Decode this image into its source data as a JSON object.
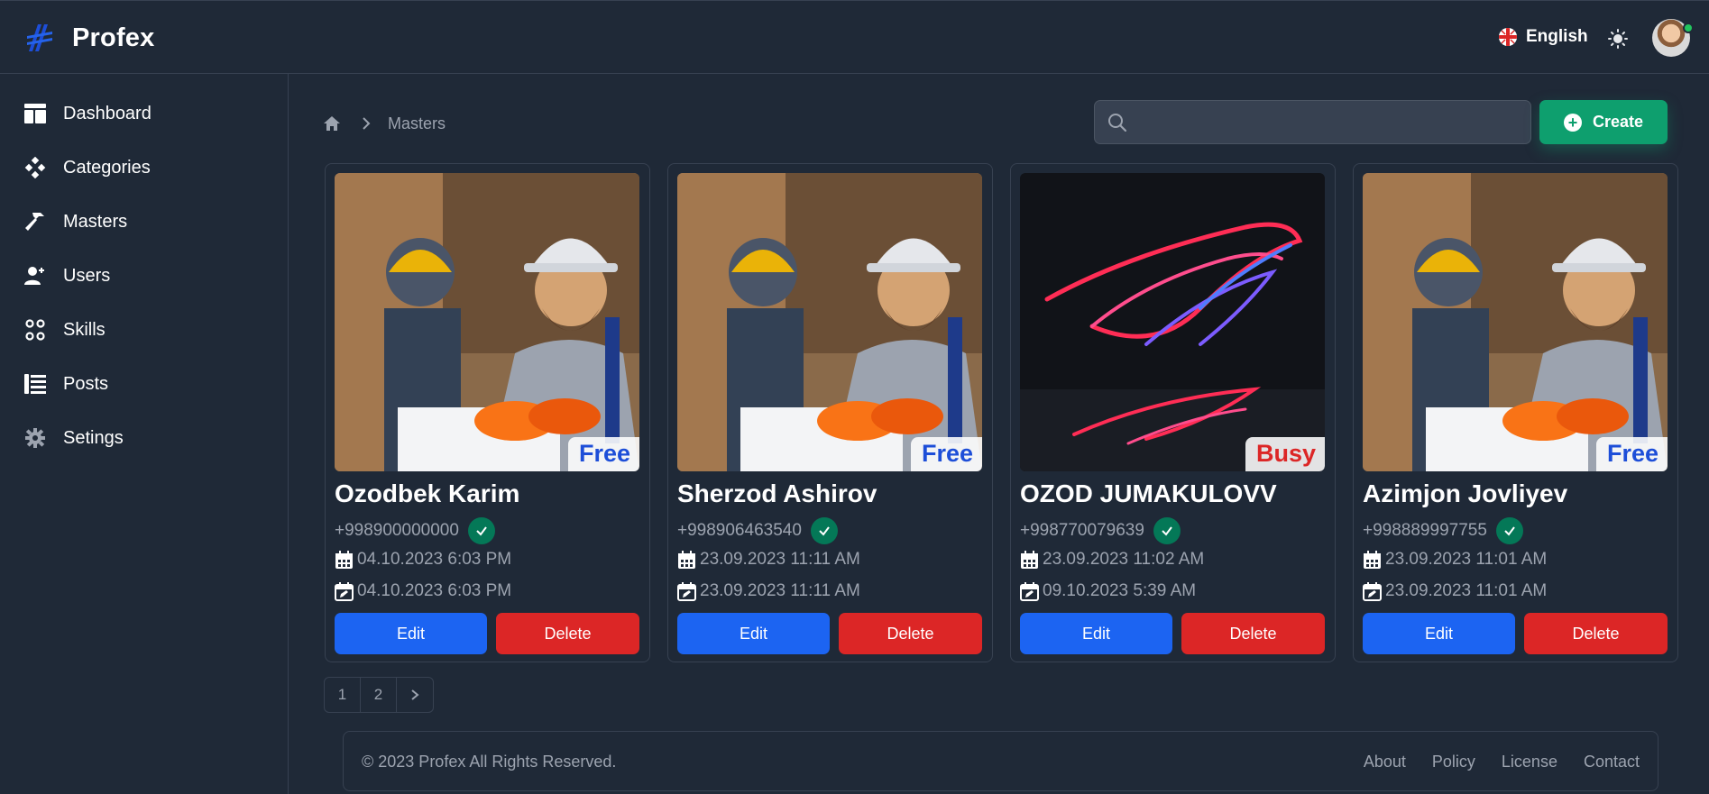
{
  "app": {
    "title": "Profex"
  },
  "header": {
    "language": "English"
  },
  "sidebar": {
    "items": [
      {
        "label": "Dashboard",
        "icon": "dashboard-icon"
      },
      {
        "label": "Categories",
        "icon": "categories-icon"
      },
      {
        "label": "Masters",
        "icon": "hammer-icon"
      },
      {
        "label": "Users",
        "icon": "user-add-icon"
      },
      {
        "label": "Skills",
        "icon": "skills-icon"
      },
      {
        "label": "Posts",
        "icon": "list-icon"
      },
      {
        "label": "Setings",
        "icon": "gear-icon"
      }
    ]
  },
  "breadcrumb": {
    "current": "Masters"
  },
  "search": {
    "placeholder": ""
  },
  "toolbar": {
    "create_label": "Create"
  },
  "cards": [
    {
      "name": "Ozodbek Karim",
      "phone": "+998900000000",
      "created": "04.10.2023 6:03 PM",
      "updated": "04.10.2023 6:03 PM",
      "status": "Free",
      "image": "worker-photo",
      "edit_label": "Edit",
      "delete_label": "Delete"
    },
    {
      "name": "Sherzod Ashirov",
      "phone": "+998906463540",
      "created": "23.09.2023 11:11 AM",
      "updated": "23.09.2023 11:11 AM",
      "status": "Free",
      "image": "worker-photo",
      "edit_label": "Edit",
      "delete_label": "Delete"
    },
    {
      "name": "OZOD JUMAKULOVV",
      "phone": "+998770079639",
      "created": "23.09.2023 11:02 AM",
      "updated": "09.10.2023 5:39 AM",
      "status": "Busy",
      "image": "neon-logo",
      "edit_label": "Edit",
      "delete_label": "Delete"
    },
    {
      "name": "Azimjon Jovliyev",
      "phone": "+998889997755",
      "created": "23.09.2023 11:01 AM",
      "updated": "23.09.2023 11:01 AM",
      "status": "Free",
      "image": "worker-photo",
      "edit_label": "Edit",
      "delete_label": "Delete"
    }
  ],
  "pagination": {
    "pages": [
      "1",
      "2"
    ]
  },
  "footer": {
    "copyright": "© 2023 Profex All Rights Reserved.",
    "links": [
      "About",
      "Policy",
      "License",
      "Contact"
    ]
  },
  "colors": {
    "background": "#1f2937",
    "primary": "#1c64f2",
    "danger": "#dc2626",
    "success": "#0e9f6e",
    "free": "#1d4ed8",
    "busy": "#dc2626"
  }
}
